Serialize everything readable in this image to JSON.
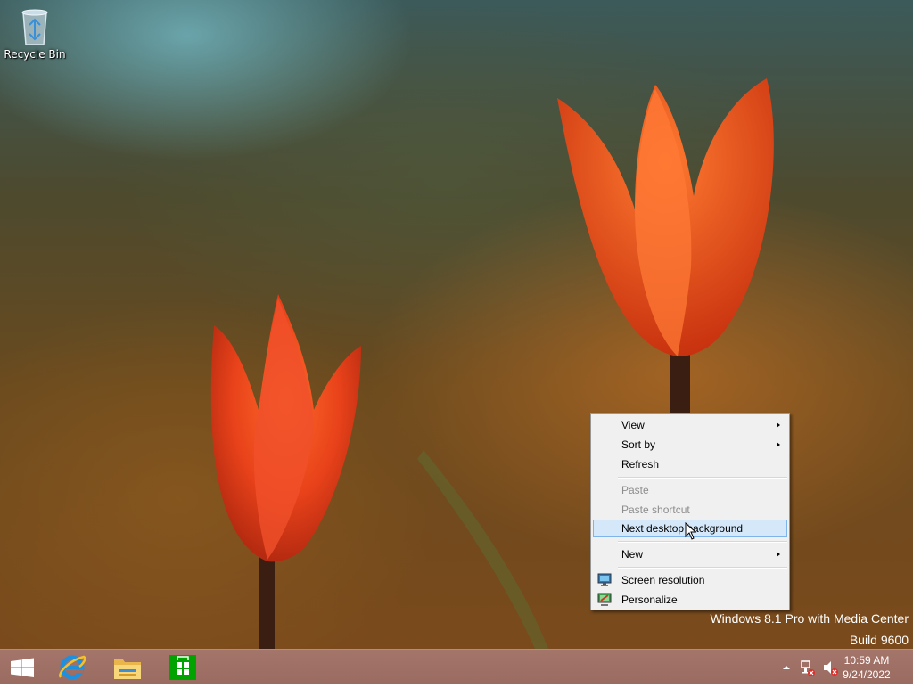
{
  "desktop": {
    "icons": [
      {
        "label": "Recycle Bin",
        "icon": "recycle-bin-icon"
      }
    ]
  },
  "watermark": {
    "edition": "Windows 8.1 Pro with Media Center",
    "build": "Build 9600"
  },
  "context_menu": {
    "items": [
      {
        "label": "View",
        "submenu": true,
        "enabled": true
      },
      {
        "label": "Sort by",
        "submenu": true,
        "enabled": true
      },
      {
        "label": "Refresh",
        "enabled": true
      },
      {
        "label": "Paste",
        "enabled": false
      },
      {
        "label": "Paste shortcut",
        "enabled": false
      },
      {
        "label": "Next desktop background",
        "enabled": true,
        "highlighted": true
      },
      {
        "label": "New",
        "submenu": true,
        "enabled": true
      },
      {
        "label": "Screen resolution",
        "enabled": true,
        "icon": "display-icon"
      },
      {
        "label": "Personalize",
        "enabled": true,
        "icon": "personalize-icon"
      }
    ]
  },
  "taskbar": {
    "pinned": [
      {
        "name": "Start",
        "icon": "windows-logo-icon"
      },
      {
        "name": "Internet Explorer",
        "icon": "internet-explorer-icon"
      },
      {
        "name": "File Explorer",
        "icon": "file-explorer-icon"
      },
      {
        "name": "Store",
        "icon": "store-icon"
      }
    ],
    "tray": {
      "icons": [
        "show-hidden-icons-icon",
        "network-error-icon",
        "volume-muted-icon"
      ],
      "time": "10:59 AM",
      "date": "9/24/2022"
    }
  },
  "colors": {
    "taskbar": "#9d6e63",
    "menu_background": "#f0f0f0",
    "menu_highlight": "#d5e8fa",
    "menu_highlight_border": "#7eb4ea",
    "store_green": "#00a300",
    "tulip_red": "#e8441a"
  }
}
